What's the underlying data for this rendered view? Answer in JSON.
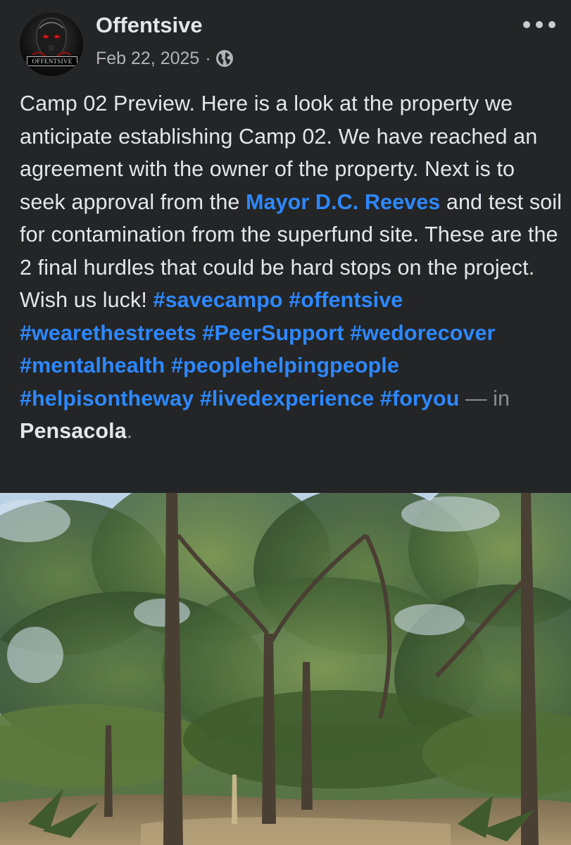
{
  "post": {
    "author": "Offentsive",
    "avatar_text": "OFFENTSIVE",
    "date": "Feb 22, 2025",
    "date_separator": "·",
    "audience_icon": "globe-icon",
    "more_icon": "more-horizontal-icon",
    "text": {
      "intro": "Camp 02 Preview. Here is a look at the property we anticipate establishing Camp 02. We have reached an agreement with the owner of the property. Next is to seek approval from the ",
      "mention": "Mayor D.C. Reeves",
      "middle": " and test soil for contamination from the superfund site. These are the 2 final hurdles that could be hard stops on the project. Wish us luck! ",
      "hashtags": [
        "#savecampo",
        "#offentsive",
        "#wearethestreets",
        "#PeerSupport",
        "#wedorecover",
        "#mentalhealth",
        "#peoplehelpingpeople",
        "#helpisontheway",
        "#livedexperience",
        "#foryou"
      ],
      "location_prefix": " — in ",
      "location": "Pensacola",
      "location_suffix": "."
    },
    "photo": {
      "description_icon": "forest-photo"
    }
  },
  "colors": {
    "background": "#242526",
    "text": "#e4e6eb",
    "secondary_text": "#b0b3b8",
    "link": "#2d88ff"
  }
}
